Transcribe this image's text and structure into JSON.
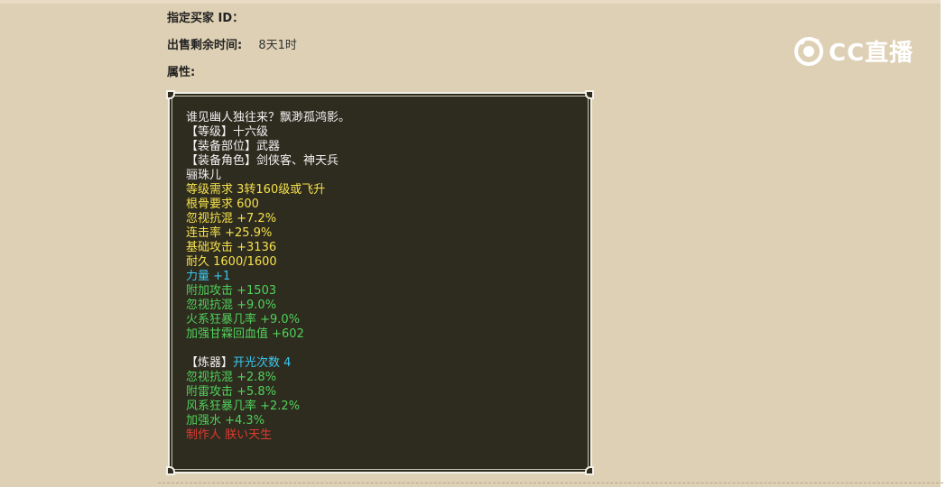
{
  "fields": {
    "buyer_label": "指定买家 ID：",
    "time_label": "出售剩余时间:",
    "time_value": "8天1时",
    "attr_label": "属性:"
  },
  "logo": {
    "text": "CC直播",
    "icon": "cc-logo-icon"
  },
  "item": {
    "desc": "谁见幽人独往来？飘渺孤鸿影。",
    "level": "【等级】十六级",
    "slot": "【装备部位】武器",
    "role": "【装备角色】剑侠客、神天兵",
    "name": "骊珠儿",
    "req_level": "等级需求 3转160级或飞升",
    "req_bone": "根骨要求 600",
    "y1": "忽视抗混 +7.2%",
    "y2": "连击率 +25.9%",
    "y3": "基础攻击 +3136",
    "y4": "耐久 1600/1600",
    "c1": "力量 +1",
    "g1": "附加攻击 +1503",
    "g2": "忽视抗混 +9.0%",
    "g3": "火系狂暴几率 +9.0%",
    "g4": "加强甘霖回血值 +602",
    "refine_label": "【炼器】",
    "refine_count": "开光次数 4",
    "r1": "忽视抗混 +2.8%",
    "r2": "附雷攻击 +5.8%",
    "r3": "风系狂暴几率 +2.2%",
    "r4": "加强水 +4.3%",
    "maker": "制作人 朕い天生"
  },
  "colors": {
    "background": "#ded0b4",
    "panel": "#2e2b1f",
    "white_text": "#f2f2f2",
    "yellow_text": "#f5e24c",
    "cyan_text": "#38c8ee",
    "green_text": "#4fd25a",
    "red_text": "#e03a30"
  }
}
